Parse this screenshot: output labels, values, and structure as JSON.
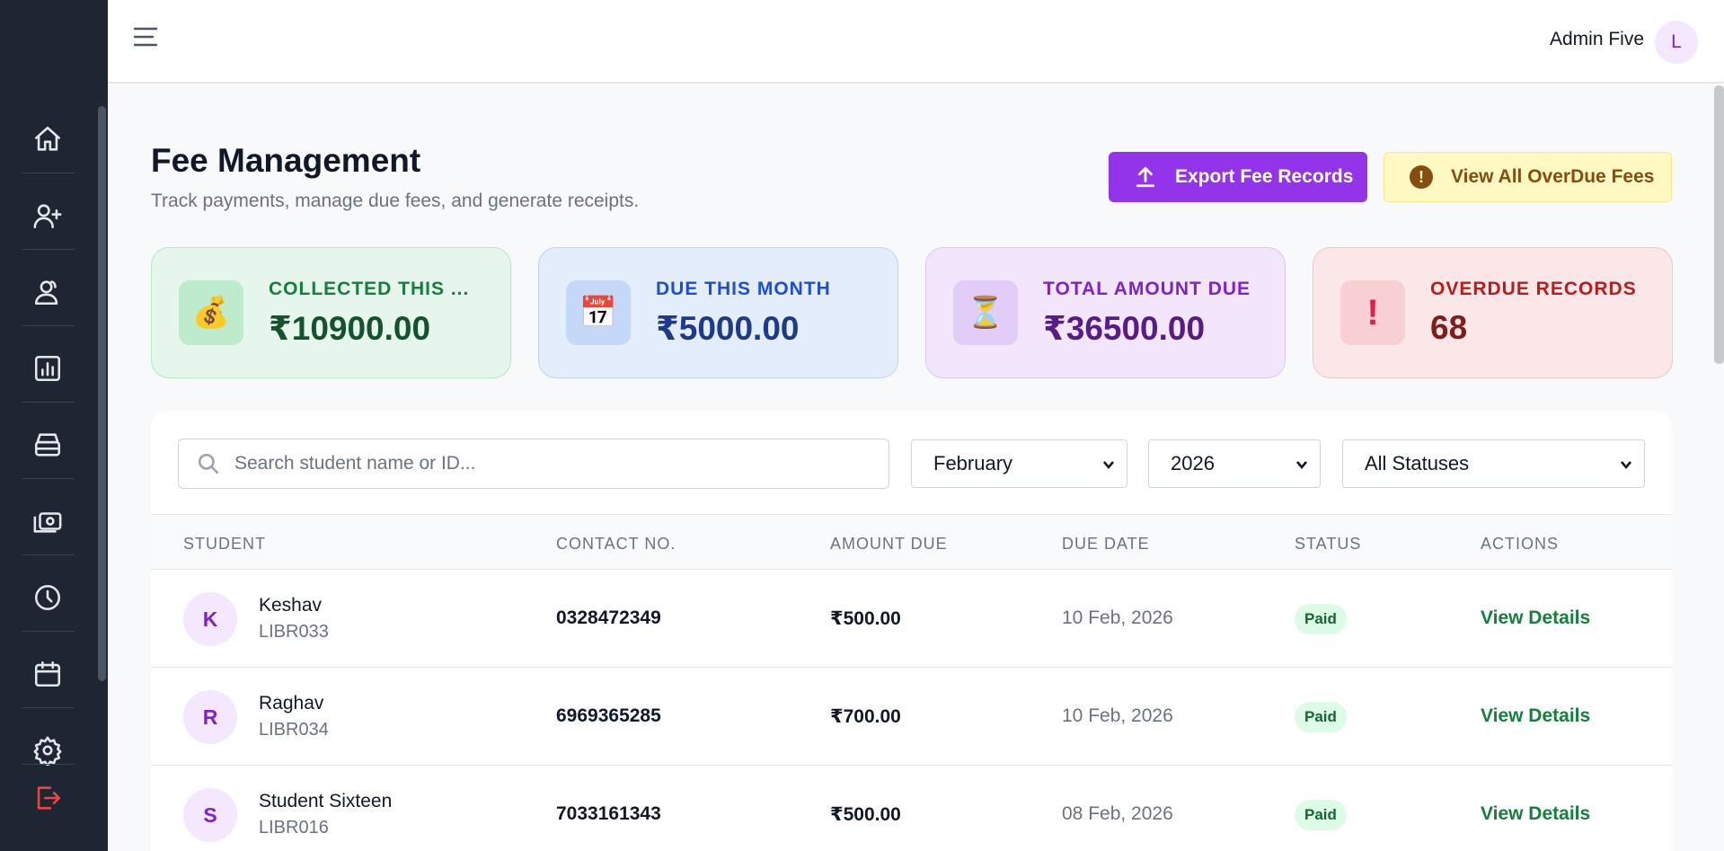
{
  "topbar": {
    "user_name": "Admin Five",
    "avatar_initial": "L"
  },
  "sidebar": {
    "items": [
      {
        "icon": "home-icon"
      },
      {
        "icon": "user-plus-icon"
      },
      {
        "icon": "users-icon"
      },
      {
        "icon": "chart-icon"
      },
      {
        "icon": "archive-icon"
      },
      {
        "icon": "cash-icon"
      },
      {
        "icon": "clock-icon"
      },
      {
        "icon": "calendar-icon"
      },
      {
        "icon": "gear-icon"
      },
      {
        "icon": "logout-icon"
      }
    ]
  },
  "header": {
    "title": "Fee Management",
    "subtitle": "Track payments, manage due fees, and generate receipts.",
    "export_label": "Export Fee Records",
    "overdue_label": "View All OverDue Fees"
  },
  "stats": [
    {
      "label": "COLLECTED THIS ...",
      "value": "₹10900.00",
      "icon": "💰"
    },
    {
      "label": "DUE THIS MONTH",
      "value": "₹5000.00",
      "icon": "📅"
    },
    {
      "label": "TOTAL AMOUNT DUE",
      "value": "₹36500.00",
      "icon": "⏳"
    },
    {
      "label": "OVERDUE RECORDS",
      "value": "68",
      "icon": "!"
    }
  ],
  "filters": {
    "search_placeholder": "Search student name or ID...",
    "month": "February",
    "year": "2026",
    "status": "All Statuses"
  },
  "table": {
    "headers": [
      "STUDENT",
      "CONTACT NO.",
      "AMOUNT DUE",
      "DUE DATE",
      "STATUS",
      "ACTIONS"
    ],
    "rows": [
      {
        "initial": "K",
        "name": "Keshav",
        "id": "LIBR033",
        "contact": "0328472349",
        "amount": "₹500.00",
        "due_date": "10 Feb, 2026",
        "status": "Paid",
        "action": "View Details"
      },
      {
        "initial": "R",
        "name": "Raghav",
        "id": "LIBR034",
        "contact": "6969365285",
        "amount": "₹700.00",
        "due_date": "10 Feb, 2026",
        "status": "Paid",
        "action": "View Details"
      },
      {
        "initial": "S",
        "name": "Student Sixteen",
        "id": "LIBR016",
        "contact": "7033161343",
        "amount": "₹500.00",
        "due_date": "08 Feb, 2026",
        "status": "Paid",
        "action": "View Details"
      }
    ]
  },
  "colors": {
    "primary": "#9333ea",
    "sidebar": "#1f2633",
    "success": "#15803d",
    "warning_bg": "#fef9c3"
  }
}
